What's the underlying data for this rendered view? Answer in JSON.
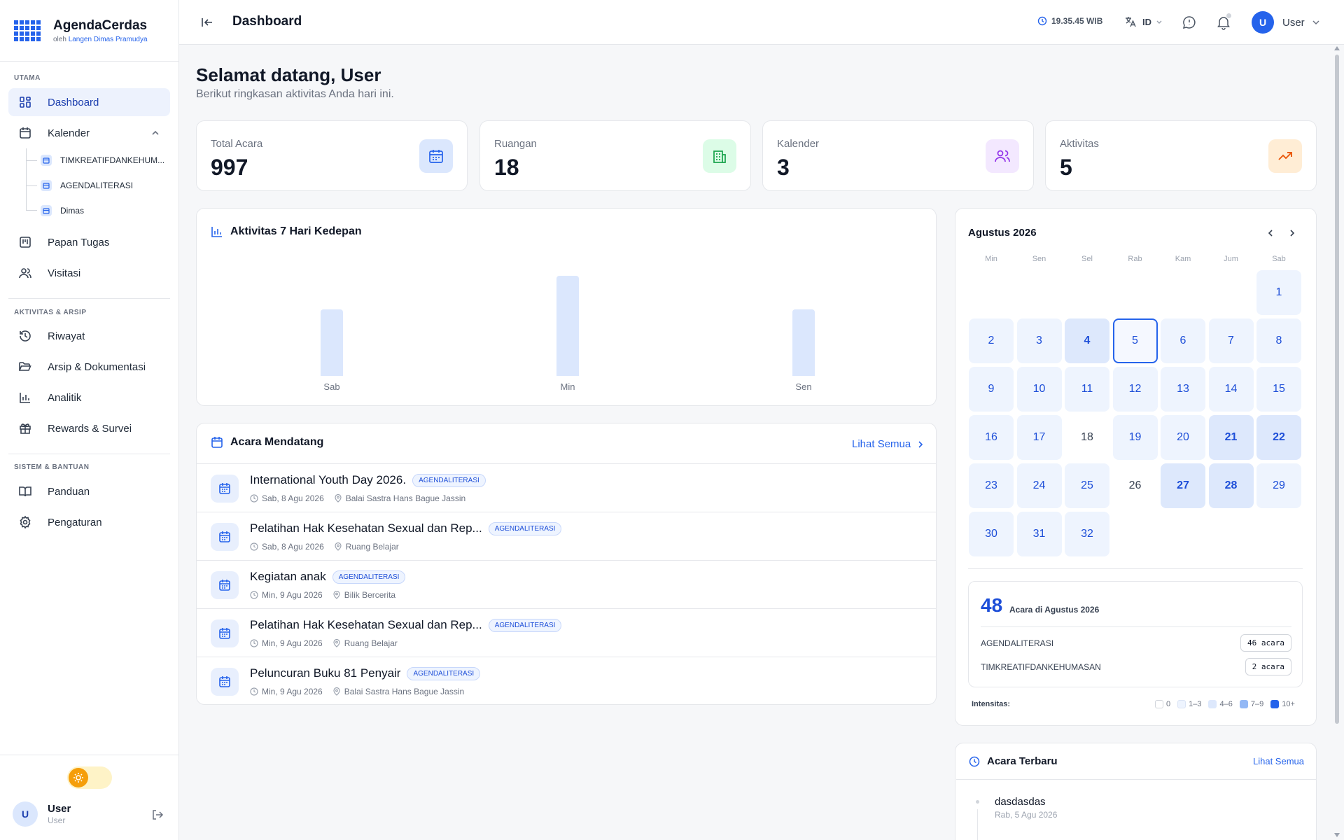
{
  "app": {
    "name": "AgendaCerdas",
    "by_prefix": "oleh",
    "by_name": "Langen Dimas Pramudya"
  },
  "sidebar": {
    "sections": [
      "UTAMA",
      "AKTIVITAS & ARSIP",
      "SISTEM & BANTUAN"
    ],
    "dashboard": "Dashboard",
    "kalender": "Kalender",
    "calendars": [
      "TIMKREATIFDANKEHUM...",
      "AGENDALITERASI",
      "Dimas"
    ],
    "papan_tugas": "Papan Tugas",
    "visitasi": "Visitasi",
    "riwayat": "Riwayat",
    "arsip": "Arsip & Dokumentasi",
    "analitik": "Analitik",
    "rewards": "Rewards & Survei",
    "panduan": "Panduan",
    "pengaturan": "Pengaturan",
    "user": {
      "initial": "U",
      "name": "User",
      "role": "User"
    }
  },
  "header": {
    "title": "Dashboard",
    "clock": "19.35.45 WIB",
    "language": "ID",
    "user_initial": "U",
    "user_name": "User"
  },
  "welcome": {
    "title": "Selamat datang, User",
    "subtitle": "Berikut ringkasan aktivitas Anda hari ini."
  },
  "stats": [
    {
      "label": "Total Acara",
      "value": "997",
      "icon": "calendar-icon",
      "color": "#2563eb",
      "bg": "#dbe7fd"
    },
    {
      "label": "Ruangan",
      "value": "18",
      "icon": "building-icon",
      "color": "#16a34a",
      "bg": "#dcfce7"
    },
    {
      "label": "Kalender",
      "value": "3",
      "icon": "users-icon",
      "color": "#9333ea",
      "bg": "#f3e8ff"
    },
    {
      "label": "Aktivitas",
      "value": "5",
      "icon": "trending-up-icon",
      "color": "#ea580c",
      "bg": "#ffedd5"
    }
  ],
  "activity_chart": {
    "title": "Aktivitas 7 Hari Kedepan"
  },
  "chart_data": {
    "type": "bar",
    "categories": [
      "Sab",
      "Min",
      "Sen"
    ],
    "values": [
      2,
      3,
      2
    ],
    "color": "#dbe7fd"
  },
  "upcoming": {
    "title": "Acara Mendatang",
    "see_all": "Lihat Semua",
    "events": [
      {
        "title": "International Youth Day 2026.",
        "tag": "AGENDALITERASI",
        "date": "Sab, 8 Agu 2026",
        "place": "Balai Sastra Hans Bague Jassin"
      },
      {
        "title": "Pelatihan Hak Kesehatan Sexual dan Rep...",
        "tag": "AGENDALITERASI",
        "date": "Sab, 8 Agu 2026",
        "place": "Ruang Belajar"
      },
      {
        "title": "Kegiatan anak",
        "tag": "AGENDALITERASI",
        "date": "Min, 9 Agu 2026",
        "place": "Bilik Bercerita"
      },
      {
        "title": "Pelatihan Hak Kesehatan Sexual dan Rep...",
        "tag": "AGENDALITERASI",
        "date": "Min, 9 Agu 2026",
        "place": "Ruang Belajar"
      },
      {
        "title": "Peluncuran Buku 81 Penyair",
        "tag": "AGENDALITERASI",
        "date": "Min, 9 Agu 2026",
        "place": "Balai Sastra Hans Bague Jassin"
      }
    ]
  },
  "calendar": {
    "month_label": "Agustus 2026",
    "weekdays": [
      "Min",
      "Sen",
      "Sel",
      "Rab",
      "Kam",
      "Jum",
      "Sab"
    ],
    "first_weekday_index": 6,
    "today": 5,
    "intensity": [
      1,
      1,
      1,
      2,
      1,
      1,
      1,
      1,
      1,
      1,
      1,
      1,
      1,
      1,
      1,
      1,
      1,
      0,
      1,
      1,
      2,
      2,
      1,
      1,
      1,
      0,
      2,
      2,
      1,
      1,
      1,
      1
    ],
    "summary": {
      "count": "48",
      "label": "Acara di Agustus 2026",
      "rows": [
        {
          "name": "AGENDALITERASI",
          "value": "46 acara"
        },
        {
          "name": "TIMKREATIFDANKEHUMASAN",
          "value": "2 acara"
        }
      ]
    },
    "legend_title": "Intensitas:",
    "legend": [
      {
        "label": "0",
        "color": "#ffffff"
      },
      {
        "label": "1–3",
        "color": "#eef4fe"
      },
      {
        "label": "4–6",
        "color": "#dde8fc"
      },
      {
        "label": "7–9",
        "color": "#93b8f5"
      },
      {
        "label": "10+",
        "color": "#2563eb"
      }
    ]
  },
  "recent": {
    "title": "Acara Terbaru",
    "see_all": "Lihat Semua",
    "items": [
      {
        "name": "dasdasdas",
        "date": "Rab, 5 Agu 2026"
      }
    ]
  }
}
